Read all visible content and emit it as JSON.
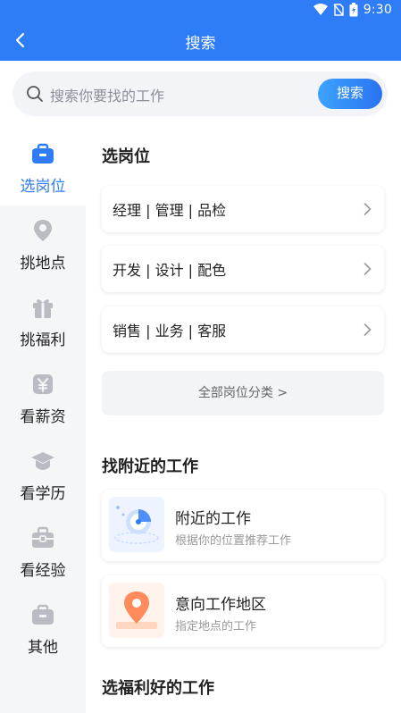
{
  "status_bar": {
    "time": "9:30"
  },
  "nav": {
    "title": "搜索"
  },
  "search": {
    "placeholder": "搜索你要找的工作",
    "button_label": "搜索"
  },
  "sidebar": {
    "items": [
      {
        "label": "选岗位",
        "icon": "briefcase-icon",
        "active": true
      },
      {
        "label": "挑地点",
        "icon": "location-pin-icon",
        "active": false
      },
      {
        "label": "挑福利",
        "icon": "gift-icon",
        "active": false
      },
      {
        "label": "看薪资",
        "icon": "yen-icon",
        "active": false
      },
      {
        "label": "看学历",
        "icon": "graduation-cap-icon",
        "active": false
      },
      {
        "label": "看经验",
        "icon": "toolbox-icon",
        "active": false
      },
      {
        "label": "其他",
        "icon": "bag-icon",
        "active": false
      }
    ]
  },
  "main": {
    "section_jobs": "选岗位",
    "categories": [
      {
        "label": "经理 | 管理 | 品检"
      },
      {
        "label": "开发 | 设计 | 配色"
      },
      {
        "label": "销售 | 业务 | 客服"
      }
    ],
    "all_categories": "全部岗位分类 >",
    "section_nearby": "找附近的工作",
    "nearby": [
      {
        "title": "附近的工作",
        "subtitle": "根据你的位置推荐工作",
        "icon": "radar-icon"
      },
      {
        "title": "意向工作地区",
        "subtitle": "指定地点的工作",
        "icon": "map-pin-icon"
      }
    ],
    "section_benefits": "选福利好的工作"
  },
  "colors": {
    "primary": "#2e7cf6",
    "sidebar_bg": "#f5f6f8",
    "icon_gray": "#b9bcc3"
  }
}
